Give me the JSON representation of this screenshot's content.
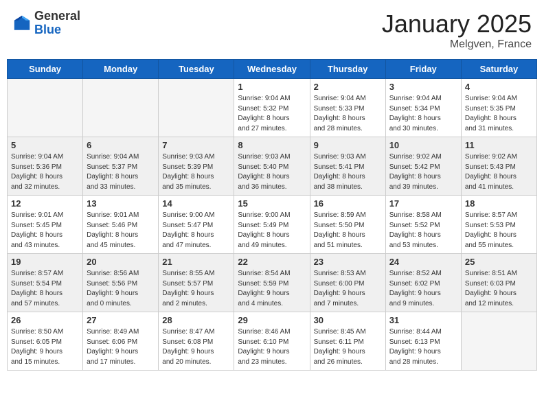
{
  "header": {
    "logo_general": "General",
    "logo_blue": "Blue",
    "month_title": "January 2025",
    "location": "Melgven, France"
  },
  "weekdays": [
    "Sunday",
    "Monday",
    "Tuesday",
    "Wednesday",
    "Thursday",
    "Friday",
    "Saturday"
  ],
  "weeks": [
    {
      "shade": false,
      "days": [
        {
          "num": "",
          "info": ""
        },
        {
          "num": "",
          "info": ""
        },
        {
          "num": "",
          "info": ""
        },
        {
          "num": "1",
          "info": "Sunrise: 9:04 AM\nSunset: 5:32 PM\nDaylight: 8 hours\nand 27 minutes."
        },
        {
          "num": "2",
          "info": "Sunrise: 9:04 AM\nSunset: 5:33 PM\nDaylight: 8 hours\nand 28 minutes."
        },
        {
          "num": "3",
          "info": "Sunrise: 9:04 AM\nSunset: 5:34 PM\nDaylight: 8 hours\nand 30 minutes."
        },
        {
          "num": "4",
          "info": "Sunrise: 9:04 AM\nSunset: 5:35 PM\nDaylight: 8 hours\nand 31 minutes."
        }
      ]
    },
    {
      "shade": true,
      "days": [
        {
          "num": "5",
          "info": "Sunrise: 9:04 AM\nSunset: 5:36 PM\nDaylight: 8 hours\nand 32 minutes."
        },
        {
          "num": "6",
          "info": "Sunrise: 9:04 AM\nSunset: 5:37 PM\nDaylight: 8 hours\nand 33 minutes."
        },
        {
          "num": "7",
          "info": "Sunrise: 9:03 AM\nSunset: 5:39 PM\nDaylight: 8 hours\nand 35 minutes."
        },
        {
          "num": "8",
          "info": "Sunrise: 9:03 AM\nSunset: 5:40 PM\nDaylight: 8 hours\nand 36 minutes."
        },
        {
          "num": "9",
          "info": "Sunrise: 9:03 AM\nSunset: 5:41 PM\nDaylight: 8 hours\nand 38 minutes."
        },
        {
          "num": "10",
          "info": "Sunrise: 9:02 AM\nSunset: 5:42 PM\nDaylight: 8 hours\nand 39 minutes."
        },
        {
          "num": "11",
          "info": "Sunrise: 9:02 AM\nSunset: 5:43 PM\nDaylight: 8 hours\nand 41 minutes."
        }
      ]
    },
    {
      "shade": false,
      "days": [
        {
          "num": "12",
          "info": "Sunrise: 9:01 AM\nSunset: 5:45 PM\nDaylight: 8 hours\nand 43 minutes."
        },
        {
          "num": "13",
          "info": "Sunrise: 9:01 AM\nSunset: 5:46 PM\nDaylight: 8 hours\nand 45 minutes."
        },
        {
          "num": "14",
          "info": "Sunrise: 9:00 AM\nSunset: 5:47 PM\nDaylight: 8 hours\nand 47 minutes."
        },
        {
          "num": "15",
          "info": "Sunrise: 9:00 AM\nSunset: 5:49 PM\nDaylight: 8 hours\nand 49 minutes."
        },
        {
          "num": "16",
          "info": "Sunrise: 8:59 AM\nSunset: 5:50 PM\nDaylight: 8 hours\nand 51 minutes."
        },
        {
          "num": "17",
          "info": "Sunrise: 8:58 AM\nSunset: 5:52 PM\nDaylight: 8 hours\nand 53 minutes."
        },
        {
          "num": "18",
          "info": "Sunrise: 8:57 AM\nSunset: 5:53 PM\nDaylight: 8 hours\nand 55 minutes."
        }
      ]
    },
    {
      "shade": true,
      "days": [
        {
          "num": "19",
          "info": "Sunrise: 8:57 AM\nSunset: 5:54 PM\nDaylight: 8 hours\nand 57 minutes."
        },
        {
          "num": "20",
          "info": "Sunrise: 8:56 AM\nSunset: 5:56 PM\nDaylight: 9 hours\nand 0 minutes."
        },
        {
          "num": "21",
          "info": "Sunrise: 8:55 AM\nSunset: 5:57 PM\nDaylight: 9 hours\nand 2 minutes."
        },
        {
          "num": "22",
          "info": "Sunrise: 8:54 AM\nSunset: 5:59 PM\nDaylight: 9 hours\nand 4 minutes."
        },
        {
          "num": "23",
          "info": "Sunrise: 8:53 AM\nSunset: 6:00 PM\nDaylight: 9 hours\nand 7 minutes."
        },
        {
          "num": "24",
          "info": "Sunrise: 8:52 AM\nSunset: 6:02 PM\nDaylight: 9 hours\nand 9 minutes."
        },
        {
          "num": "25",
          "info": "Sunrise: 8:51 AM\nSunset: 6:03 PM\nDaylight: 9 hours\nand 12 minutes."
        }
      ]
    },
    {
      "shade": false,
      "days": [
        {
          "num": "26",
          "info": "Sunrise: 8:50 AM\nSunset: 6:05 PM\nDaylight: 9 hours\nand 15 minutes."
        },
        {
          "num": "27",
          "info": "Sunrise: 8:49 AM\nSunset: 6:06 PM\nDaylight: 9 hours\nand 17 minutes."
        },
        {
          "num": "28",
          "info": "Sunrise: 8:47 AM\nSunset: 6:08 PM\nDaylight: 9 hours\nand 20 minutes."
        },
        {
          "num": "29",
          "info": "Sunrise: 8:46 AM\nSunset: 6:10 PM\nDaylight: 9 hours\nand 23 minutes."
        },
        {
          "num": "30",
          "info": "Sunrise: 8:45 AM\nSunset: 6:11 PM\nDaylight: 9 hours\nand 26 minutes."
        },
        {
          "num": "31",
          "info": "Sunrise: 8:44 AM\nSunset: 6:13 PM\nDaylight: 9 hours\nand 28 minutes."
        },
        {
          "num": "",
          "info": ""
        }
      ]
    }
  ]
}
